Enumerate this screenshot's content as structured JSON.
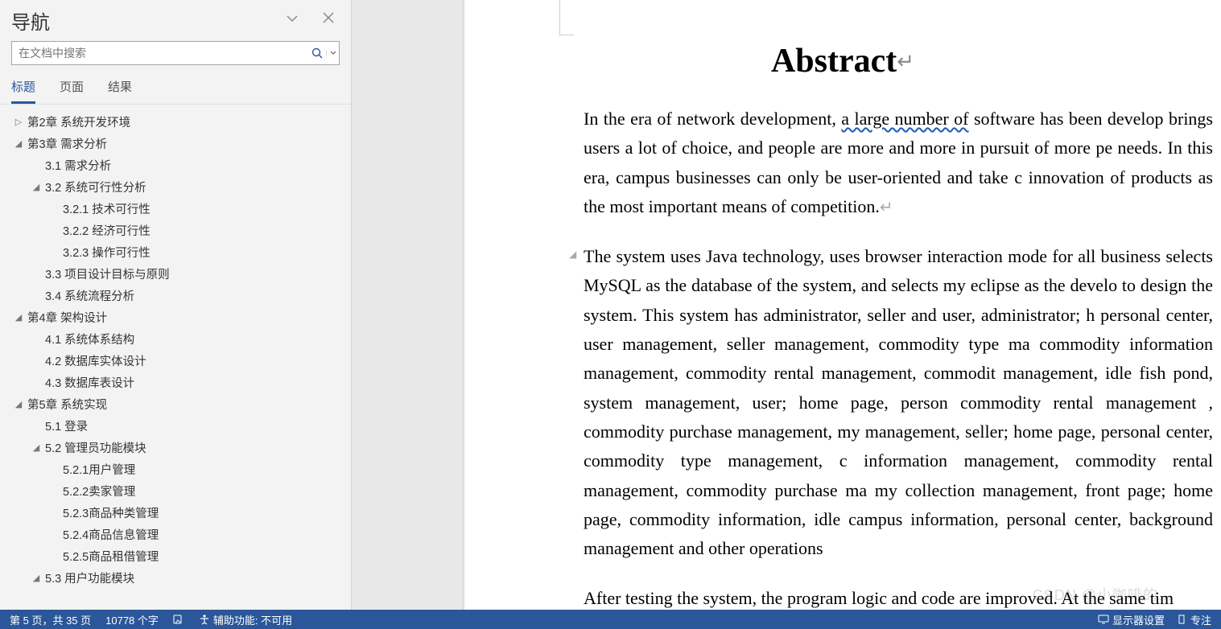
{
  "nav": {
    "title": "导航",
    "search_placeholder": "在文档中搜索",
    "tabs": {
      "headings": "标题",
      "pages": "页面",
      "results": "结果"
    },
    "outline": [
      {
        "label": "第2章  系统开发环境",
        "level": 0,
        "caret": "right"
      },
      {
        "label": "第3章  需求分析",
        "level": 0,
        "caret": "down"
      },
      {
        "label": "3.1 需求分析",
        "level": 1,
        "caret": "none"
      },
      {
        "label": "3.2 系统可行性分析",
        "level": 1,
        "caret": "down"
      },
      {
        "label": "3.2.1 技术可行性",
        "level": 2,
        "caret": "none"
      },
      {
        "label": "3.2.2 经济可行性",
        "level": 2,
        "caret": "none"
      },
      {
        "label": "3.2.3 操作可行性",
        "level": 2,
        "caret": "none"
      },
      {
        "label": "3.3 项目设计目标与原则",
        "level": 1,
        "caret": "none"
      },
      {
        "label": "3.4 系统流程分析",
        "level": 1,
        "caret": "none"
      },
      {
        "label": "第4章  架构设计",
        "level": 0,
        "caret": "down"
      },
      {
        "label": "4.1 系统体系结构",
        "level": 1,
        "caret": "none"
      },
      {
        "label": "4.2 数据库实体设计",
        "level": 1,
        "caret": "none"
      },
      {
        "label": "4.3 数据库表设计",
        "level": 1,
        "caret": "none"
      },
      {
        "label": "第5章  系统实现",
        "level": 0,
        "caret": "down"
      },
      {
        "label": "5.1 登录",
        "level": 1,
        "caret": "none"
      },
      {
        "label": "5.2  管理员功能模块",
        "level": 1,
        "caret": "down"
      },
      {
        "label": "5.2.1用户管理",
        "level": 2,
        "caret": "none"
      },
      {
        "label": "5.2.2卖家管理",
        "level": 2,
        "caret": "none"
      },
      {
        "label": "5.2.3商品种类管理",
        "level": 2,
        "caret": "none"
      },
      {
        "label": "5.2.4商品信息管理",
        "level": 2,
        "caret": "none"
      },
      {
        "label": "5.2.5商品租借管理",
        "level": 2,
        "caret": "none"
      },
      {
        "label": "5.3  用户功能模块",
        "level": 1,
        "caret": "down"
      }
    ]
  },
  "document": {
    "title": "Abstract",
    "para1_a": "In the era of network development, ",
    "para1_underline": "a large number of",
    "para1_b": " software has been develop brings users a lot of choice, and people are more and more in pursuit of more pe needs. In this era, campus businesses can only be user-oriented and take c innovation of products as the most important means of competition.",
    "para2": "The system uses Java technology, uses browser interaction mode for all business selects MySQL as the database of the system, and selects my eclipse as the develo to design the system. This system has administrator, seller and user, administrator; h personal center, user management, seller management, commodity type ma commodity information management, commodity rental management, commodit management, idle fish pond, system management, user; home page, person commodity rental management , commodity purchase management, my management, seller; home page, personal center, commodity type management, c information management, commodity rental management, commodity purchase ma my collection management, front page; home page, commodity information, idle campus information, personal center, background management and other operations",
    "para3": "After testing the system, the program logic and code are improved. At the same tim"
  },
  "statusbar": {
    "page": "第 5 页，共 35 页",
    "words": "10778 个字",
    "accessibility": "辅助功能: 不可用",
    "display": "显示器设置",
    "focus": "专注"
  },
  "watermark": "CSDN @小咖啡的..."
}
